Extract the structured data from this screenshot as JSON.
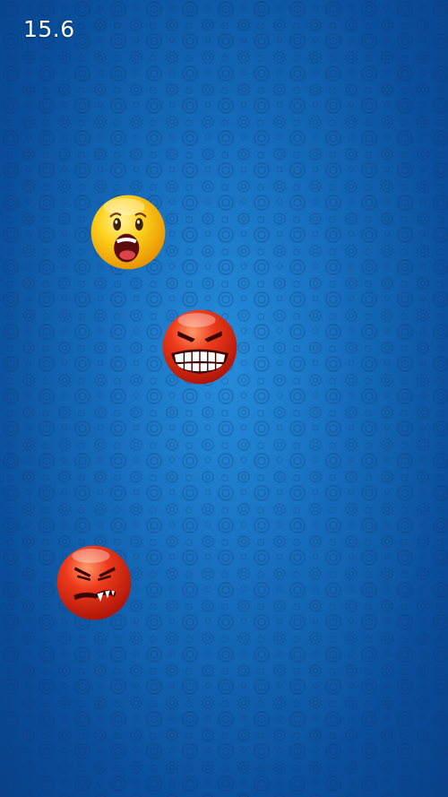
{
  "hud": {
    "timer": "15.6"
  },
  "background": {
    "pattern": "spiral-circles",
    "colors": {
      "center": "#1a7fd0",
      "mid": "#0d5fae",
      "edge": "#08418a"
    }
  },
  "faces": [
    {
      "name": "shocked-face-icon",
      "icon": "yellow-shocked-emoji"
    },
    {
      "name": "grinning-angry-face-icon",
      "icon": "red-angry-teeth-emoji"
    },
    {
      "name": "snarling-angry-face-icon",
      "icon": "red-snarl-emoji"
    }
  ],
  "colors": {
    "yellow_face": "#ffd21f",
    "red_face": "#ee3b1c"
  }
}
